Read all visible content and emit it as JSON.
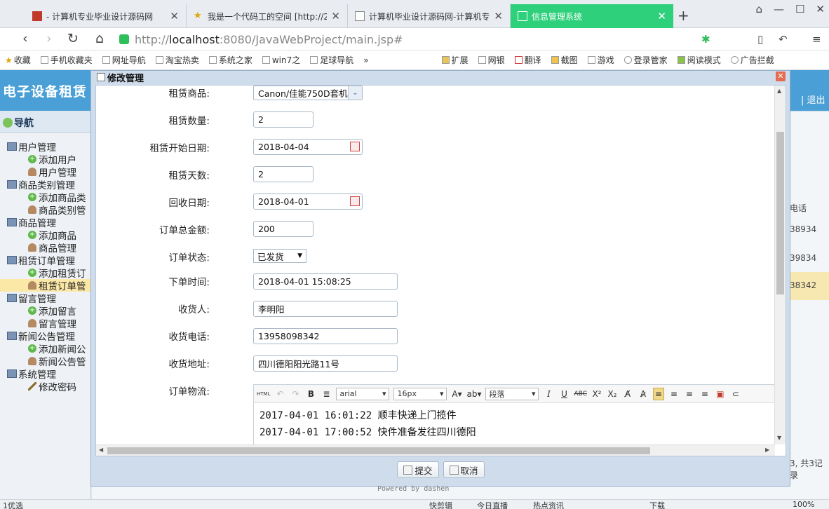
{
  "browser": {
    "tabs": [
      {
        "title": "- 计算机专业毕业设计源码网",
        "active": false
      },
      {
        "title": "我是一个代码工的空间 [http://2",
        "active": false
      },
      {
        "title": "计算机毕业设计源码网-计算机专",
        "active": false
      },
      {
        "title": "信息管理系统",
        "active": true
      }
    ],
    "new_tab": "+",
    "url_prefix": "http://",
    "url_host": "localhost",
    "url_rest": ":8080/JavaWebProject/main.jsp#",
    "bookmarks": [
      "收藏",
      "手机收藏夹",
      "网址导航",
      "淘宝热卖",
      "系统之家",
      "win7之",
      "足球导航",
      "»",
      "扩展",
      "网银",
      "翻译",
      "截图",
      "游戏",
      "登录管家",
      "阅读模式",
      "广告拦截"
    ]
  },
  "app": {
    "title": "电子设备租赁",
    "logout": "| 退出",
    "nav_title": "导航",
    "tree": [
      {
        "label": "用户管理",
        "level": 1,
        "icon": "pc"
      },
      {
        "label": "添加用户",
        "level": 2,
        "icon": "plus"
      },
      {
        "label": "用户管理",
        "level": 2,
        "icon": "user"
      },
      {
        "label": "商品类别管理",
        "level": 1,
        "icon": "pc"
      },
      {
        "label": "添加商品类",
        "level": 2,
        "icon": "plus"
      },
      {
        "label": "商品类别管",
        "level": 2,
        "icon": "user"
      },
      {
        "label": "商品管理",
        "level": 1,
        "icon": "pc"
      },
      {
        "label": "添加商品",
        "level": 2,
        "icon": "plus"
      },
      {
        "label": "商品管理",
        "level": 2,
        "icon": "user"
      },
      {
        "label": "租赁订单管理",
        "level": 1,
        "icon": "pc"
      },
      {
        "label": "添加租赁订",
        "level": 2,
        "icon": "plus"
      },
      {
        "label": "租赁订单管",
        "level": 2,
        "icon": "user",
        "selected": true
      },
      {
        "label": "留言管理",
        "level": 1,
        "icon": "pc"
      },
      {
        "label": "添加留言",
        "level": 2,
        "icon": "plus"
      },
      {
        "label": "留言管理",
        "level": 2,
        "icon": "user"
      },
      {
        "label": "新闻公告管理",
        "level": 1,
        "icon": "pc"
      },
      {
        "label": "添加新闻公",
        "level": 2,
        "icon": "plus"
      },
      {
        "label": "新闻公告管",
        "level": 2,
        "icon": "user"
      },
      {
        "label": "系统管理",
        "level": 1,
        "icon": "pc"
      },
      {
        "label": "修改密码",
        "level": 2,
        "icon": "pencil"
      }
    ],
    "bg_col_header": "电话",
    "bg_cells": [
      "38934",
      "39834",
      "38342"
    ],
    "pager": "3, 共3记录",
    "powered": "Powered by dashen"
  },
  "modal": {
    "title": "修改管理",
    "close": "✕",
    "labels": {
      "product": "租赁商品:",
      "qty": "租赁数量:",
      "start_date": "租赁开始日期:",
      "days": "租赁天数:",
      "return_date": "回收日期:",
      "total": "订单总金额:",
      "status": "订单状态:",
      "order_time": "下单时间:",
      "receiver": "收货人:",
      "phone": "收货电话:",
      "address": "收货地址:",
      "logistics": "订单物流:"
    },
    "values": {
      "product": "Canon/佳能750D套机",
      "qty": "2",
      "start_date": "2018-04-04",
      "days": "2",
      "return_date": "2018-04-01",
      "total": "200",
      "status": "已发货",
      "order_time": "2018-04-01 15:08:25",
      "receiver": "李明阳",
      "phone": "13958098342",
      "address": "四川德阳阳光路11号"
    },
    "editor": {
      "font": "arial",
      "size": "16px",
      "block": "段落",
      "lines": [
        "2017-04-01 16:01:22 顺丰快递上门揽件",
        "2017-04-01 17:00:52 快件准备发往四川德阳"
      ]
    },
    "buttons": {
      "submit": "提交",
      "cancel": "取消"
    }
  },
  "statusbar": {
    "left": "1优选",
    "items": [
      "快剪辑",
      "今日直播",
      "热点资讯",
      "下载",
      "100%"
    ]
  }
}
